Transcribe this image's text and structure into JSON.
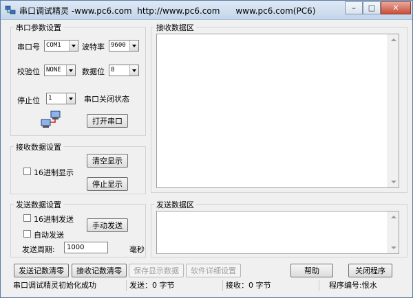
{
  "window": {
    "title": "串口调试精灵 -www.pc6.com  http://www.pc6.com      www.pc6.com(PC6)",
    "min_label": "–",
    "max_label": "□",
    "close_label": "✕"
  },
  "serial_params": {
    "title": "串口参数设置",
    "port_label": "串口号",
    "port_value": "COM1",
    "baud_label": "波特率",
    "baud_value": "9600",
    "parity_label": "校验位",
    "parity_value": "NONE",
    "databits_label": "数据位",
    "databits_value": "8",
    "stopbits_label": "停止位",
    "stopbits_value": "1",
    "port_status": "串口关闭状态",
    "open_button": "打开串口"
  },
  "receive_settings": {
    "title": "接收数据设置",
    "hex_display_label": "16进制显示",
    "clear_button": "清空显示",
    "stop_button": "停止显示"
  },
  "send_settings": {
    "title": "发送数据设置",
    "hex_send_label": "16进制发送",
    "auto_send_label": "自动发送",
    "manual_send_button": "手动发送",
    "period_label": "发送周期:",
    "period_value": "1000",
    "period_unit": "毫秒"
  },
  "receive_area": {
    "title": "接收数据区"
  },
  "send_area": {
    "title": "发送数据区"
  },
  "bottom_buttons": {
    "clear_send_count": "发送记数清零",
    "clear_recv_count": "接收记数清零",
    "save_display": "保存显示数据",
    "advanced_settings": "软件详细设置",
    "help": "帮助",
    "close_program": "关闭程序"
  },
  "status": {
    "message": "串口调试精灵初始化成功",
    "sent": "发送：0 字节",
    "received": "接收：0 字节",
    "program_id": "程序编号:恨水"
  },
  "colors": {
    "window_bg": "#f0f0f0",
    "titlebar": "#c3d5ea",
    "close_button": "#c94d3a"
  }
}
